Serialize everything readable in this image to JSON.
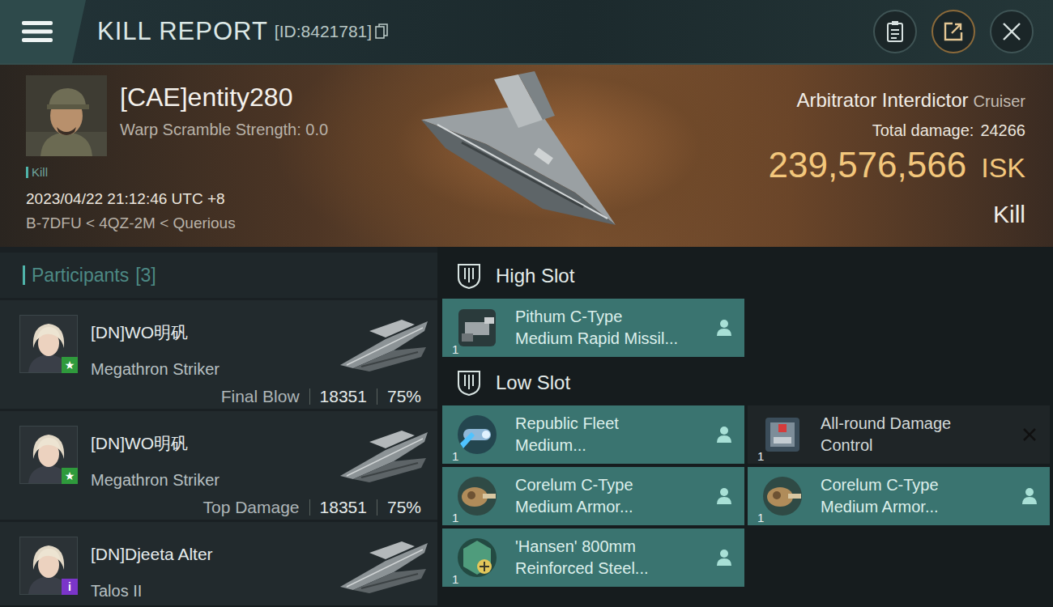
{
  "window": {
    "title": "KILL REPORT",
    "report_id": "[ID:8421781]"
  },
  "victim": {
    "name": "[CAE]entity280",
    "warp_scramble": "Warp Scramble Strength: 0.0",
    "tag": "Kill",
    "time": "2023/04/22 21:12:46 UTC +8",
    "location": "B-7DFU < 4QZ-2M < Querious",
    "ship": "Arbitrator Interdictor",
    "ship_class": "Cruiser",
    "damage_label": "Total damage:",
    "damage": "24266",
    "value": "239,576,566",
    "currency": "ISK",
    "result": "Kill"
  },
  "participants": {
    "title": "Participants",
    "count": "[3]",
    "items": [
      {
        "name": "[DN]WO明矾",
        "ship": "Megathron Striker",
        "badge": {
          "symbol": "★",
          "color": "#2f9a3c"
        },
        "role": "Final Blow",
        "damage": "18351",
        "share": "75%"
      },
      {
        "name": "[DN]WO明矾",
        "ship": "Megathron Striker",
        "badge": {
          "symbol": "★",
          "color": "#2f9a3c"
        },
        "role": "Top Damage",
        "damage": "18351",
        "share": "75%"
      },
      {
        "name": "[DN]Djeeta Alter",
        "ship": "Talos II",
        "badge": {
          "symbol": "i",
          "color": "#7b35c9"
        }
      }
    ]
  },
  "slots": [
    {
      "title": "High Slot",
      "modules": [
        {
          "kind": "launcher",
          "qty": "1",
          "name_lines": [
            "Pithum C-Type",
            "Medium Rapid Missil..."
          ],
          "dropped": true
        }
      ]
    },
    {
      "title": "Low Slot",
      "modules": [
        {
          "kind": "hardener",
          "qty": "1",
          "name_lines": [
            "Republic Fleet",
            "Medium..."
          ],
          "dropped": true
        },
        {
          "kind": "damagecontrol",
          "qty": "1",
          "name_lines": [
            "All-round Damage",
            "Control"
          ],
          "dropped": false
        },
        {
          "kind": "repairer",
          "qty": "1",
          "name_lines": [
            "Corelum C-Type",
            "Medium Armor..."
          ],
          "dropped": true
        },
        {
          "kind": "repairer",
          "qty": "1",
          "name_lines": [
            "Corelum C-Type",
            "Medium Armor..."
          ],
          "dropped": true
        },
        {
          "kind": "plate",
          "qty": "1",
          "name_lines": [
            "'Hansen' 800mm",
            "Reinforced Steel..."
          ],
          "dropped": true
        }
      ]
    }
  ]
}
